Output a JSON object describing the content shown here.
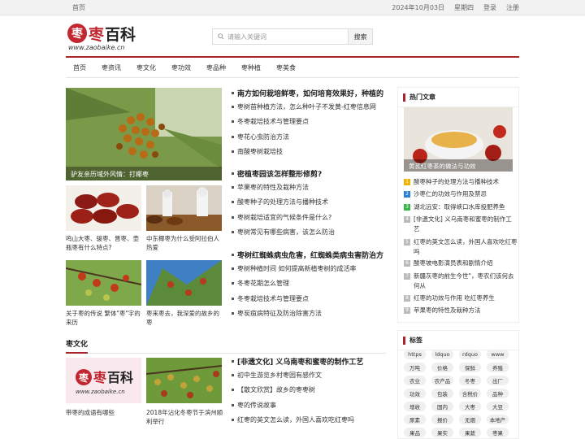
{
  "topbar": {
    "home": "首页",
    "date": "2024年10月03日",
    "weekday": "星期四",
    "login": "登录",
    "register": "注册"
  },
  "logo": {
    "domain": "www.zaobaike.cn",
    "brand": "枣百科"
  },
  "search": {
    "placeholder": "请输入关键词",
    "button": "搜索"
  },
  "nav": [
    "首页",
    "枣资讯",
    "枣文化",
    "枣功效",
    "枣品种",
    "枣种植",
    "枣美食"
  ],
  "hero": {
    "caption": "驴友亲历域外风情：打椰枣"
  },
  "thumbs": [
    {
      "caption": "鸣山大枣、骏枣、晋枣、壶瓶枣有什么特点?"
    },
    {
      "caption": "中东椰枣为什么受阿拉伯人热爱"
    },
    {
      "caption": "关于枣的传说 繁体\"枣\"字的来历"
    },
    {
      "caption": "枣来枣去，我深爱的故乡的枣"
    }
  ],
  "lists": [
    {
      "headline": "南方如何栽培鲜枣，如何培育效果好，种植的",
      "items": [
        "枣树苗种植方法，怎么种叶子不发黄-红枣信息网",
        "冬枣栽培技术与管理要点",
        "枣花心虫防治方法",
        "南酸枣树栽培技"
      ]
    },
    {
      "headline": "密植枣园该怎样整形修剪?",
      "items": [
        "苹果枣的特性及栽种方法",
        "酸枣种子的处理方法与播种技术",
        "枣树栽培适宜的气候条件是什么?",
        "枣树常见有哪些病害，该怎么防治"
      ]
    },
    {
      "headline": "枣树红蜘蛛病虫危害，红蜘蛛类病虫害防治方",
      "items": [
        "枣树种植时间 如何提高新植枣树的成活率",
        "冬枣花期怎么管理",
        "冬枣栽培技术与管理要点",
        "枣炭疽病特征及防治除害方法"
      ]
    }
  ],
  "section": {
    "title": "枣文化"
  },
  "culture": {
    "thumbs": [
      {
        "caption": "带枣的成语有哪些"
      },
      {
        "caption": "2018年沾化冬枣节于滨州顺利举行"
      }
    ],
    "headline": "[非遗文化] 义乌南枣和蜜枣的制作工艺",
    "items": [
      "初中生游览乡村枣园有感作文",
      "【散文欣赏】故乡的枣枣树",
      "枣的传说故事",
      "红枣的英文怎么读，外国人喜欢吃红枣吗"
    ]
  },
  "sidebar": {
    "hot_title": "热门文章",
    "hot_caption": "黄芪红枣茶的做法与功效",
    "hot_list": [
      {
        "num": "1",
        "color": "#f0b400",
        "text": "酸枣种子的处理方法与播种技术"
      },
      {
        "num": "2",
        "color": "#2a7fd4",
        "text": "沙枣仁的功效与作用及禁忌"
      },
      {
        "num": "3",
        "color": "#3bb54a",
        "text": "湖北远安：取得峡口水库投肥养鱼"
      },
      {
        "num": "4",
        "color": "#bbbbbb",
        "text": "[非遗文化] 义乌南枣和蜜枣的制作工艺"
      },
      {
        "num": "5",
        "color": "#bbbbbb",
        "text": "红枣的英文怎么读，外国人喜欢吃红枣吗"
      },
      {
        "num": "6",
        "color": "#bbbbbb",
        "text": "酸枣坡电影演员表和剧情介绍"
      },
      {
        "num": "7",
        "color": "#bbbbbb",
        "text": "新疆灰枣的前生今世\"，枣农们该何去何从"
      },
      {
        "num": "8",
        "color": "#bbbbbb",
        "text": "红枣的功效与作用 吃红枣养生"
      },
      {
        "num": "9",
        "color": "#bbbbbb",
        "text": "苹果枣的特性及栽种方法"
      }
    ],
    "tags_title": "标签",
    "tags": [
      "https",
      "ldquo",
      "rdquo",
      "www",
      "万吨",
      "价格",
      "保鲜",
      "养殖",
      "农业",
      "农产品",
      "冬枣",
      "出厂",
      "功效",
      "包装",
      "含税价",
      "品种",
      "增收",
      "国内",
      "大枣",
      "大豆",
      "尿素",
      "报价",
      "无烟",
      "本地产",
      "果品",
      "果实",
      "果蔬",
      "枣果"
    ]
  },
  "colors": {
    "accent": "#a8232b"
  }
}
